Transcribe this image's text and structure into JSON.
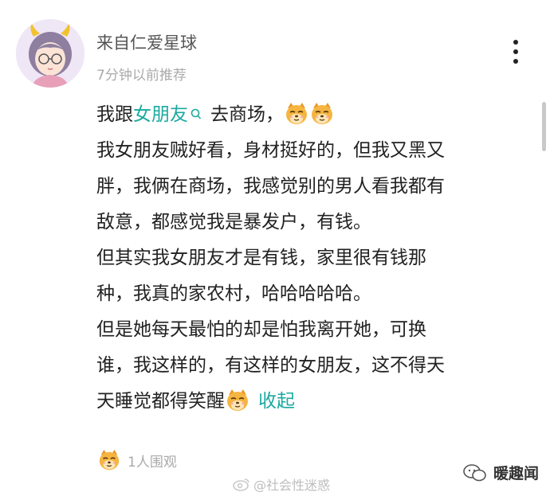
{
  "post": {
    "username": "来自仁爱星球",
    "meta": "7分钟以前推荐",
    "lines": [
      {
        "parts": [
          {
            "t": "text",
            "v": "我跟"
          },
          {
            "t": "hl",
            "v": "女朋友"
          },
          {
            "t": "search"
          },
          {
            "t": "text",
            "v": "去商场，"
          },
          {
            "t": "emoji"
          },
          {
            "t": "emoji"
          }
        ]
      },
      {
        "parts": [
          {
            "t": "text",
            "v": "我女朋友贼好看，身材挺好的，但我又黑又"
          }
        ]
      },
      {
        "parts": [
          {
            "t": "text",
            "v": "胖，我俩在商场，我感觉别的男人看我都有"
          }
        ]
      },
      {
        "parts": [
          {
            "t": "text",
            "v": "敌意，都感觉我是暴发户，有钱。"
          }
        ]
      },
      {
        "parts": [
          {
            "t": "text",
            "v": "但其实我女朋友才是有钱，家里很有钱那"
          }
        ]
      },
      {
        "parts": [
          {
            "t": "text",
            "v": "种，我真的家农村，哈哈哈哈哈。"
          }
        ]
      },
      {
        "parts": [
          {
            "t": "text",
            "v": "但是她每天最怕的却是怕我离开她，可换"
          }
        ]
      },
      {
        "parts": [
          {
            "t": "text",
            "v": "谁，我这样的，有这样的女朋友，这不得天"
          }
        ]
      },
      {
        "parts": [
          {
            "t": "text",
            "v": "天睡觉都得笑醒"
          },
          {
            "t": "emoji"
          },
          {
            "t": "collapse",
            "v": "收起"
          }
        ]
      }
    ],
    "viewers": "1人围观"
  },
  "watermarks": {
    "weibo": "@社会性迷惑",
    "wechat": "暖趣闻"
  },
  "colors": {
    "highlight": "#1aa9a0",
    "meta": "#aaaaaa"
  },
  "icons": {
    "avatar": "girl-avatar-with-horns",
    "more": "vertical-dots-icon",
    "emoji": "dog-face-emoji",
    "search": "search-icon"
  }
}
